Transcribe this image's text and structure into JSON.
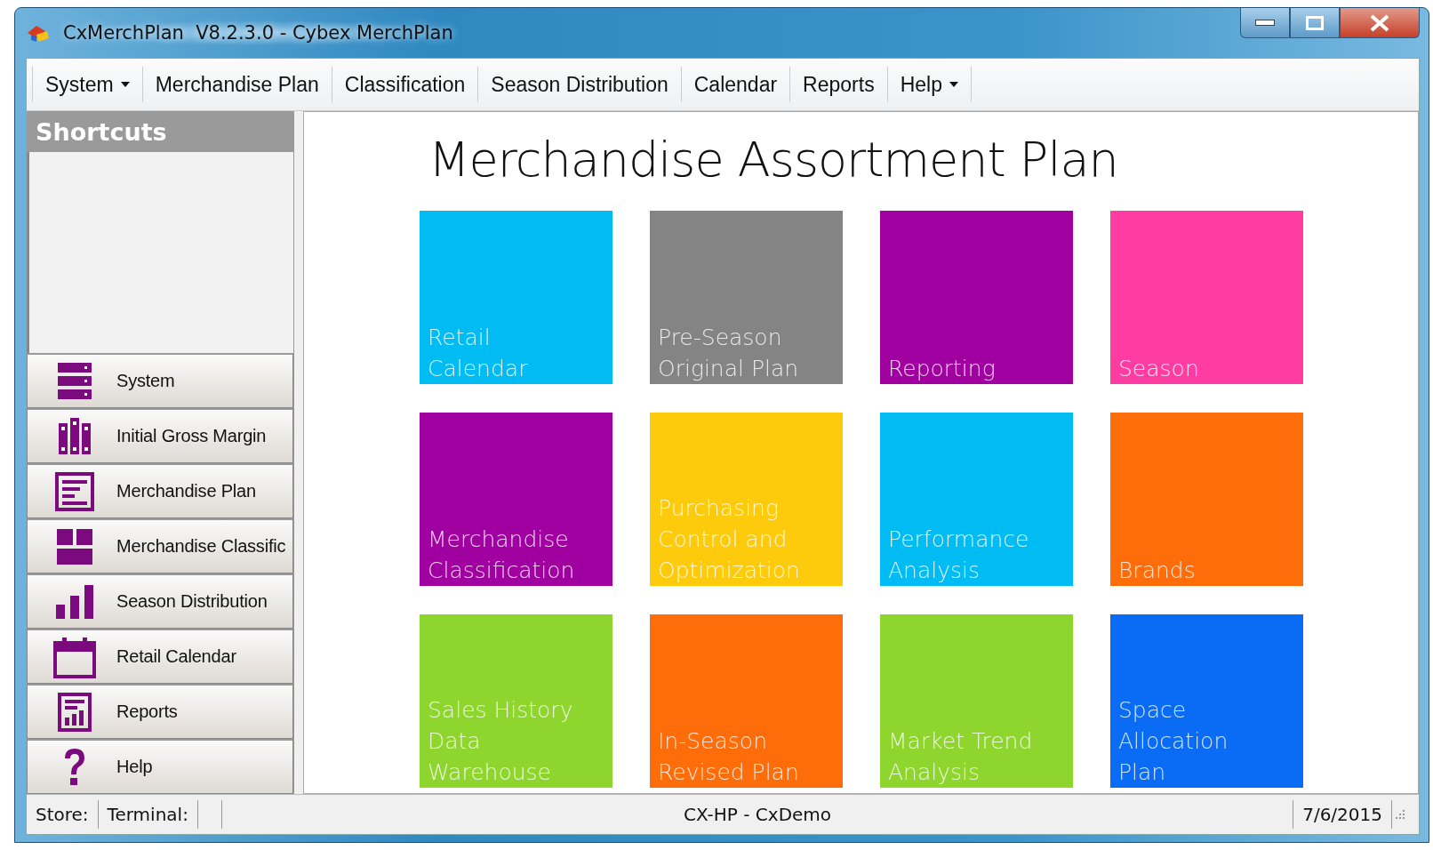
{
  "window": {
    "title": "CxMerchPlan  V8.2.3.0 - Cybex MerchPlan"
  },
  "menu": [
    {
      "label": "System",
      "dropdown": true
    },
    {
      "label": "Merchandise Plan",
      "dropdown": false
    },
    {
      "label": "Classification",
      "dropdown": false
    },
    {
      "label": "Season Distribution",
      "dropdown": false
    },
    {
      "label": "Calendar",
      "dropdown": false
    },
    {
      "label": "Reports",
      "dropdown": false
    },
    {
      "label": "Help",
      "dropdown": true
    }
  ],
  "sidebar": {
    "title": "Shortcuts",
    "items": [
      {
        "label": "System",
        "kind": "server"
      },
      {
        "label": "Initial Gross Margin",
        "kind": "columns"
      },
      {
        "label": "Merchandise Plan",
        "kind": "document"
      },
      {
        "label": "Merchandise Classific",
        "kind": "blocks"
      },
      {
        "label": "Season Distribution",
        "kind": "bars"
      },
      {
        "label": "Retail Calendar",
        "kind": "calendar"
      },
      {
        "label": "Reports",
        "kind": "report"
      },
      {
        "label": "Help",
        "kind": "question"
      }
    ]
  },
  "main": {
    "title": "Merchandise Assortment Plan",
    "tiles": [
      {
        "label": "Retail\nCalendar",
        "color": "#00bcf2"
      },
      {
        "label": "Pre-Season\nOriginal Plan",
        "color": "#848484"
      },
      {
        "label": "Reporting",
        "color": "#a0009f"
      },
      {
        "label": "Season",
        "color": "#ff3ca2"
      },
      {
        "label": "Merchandise\nClassification",
        "color": "#a0009f"
      },
      {
        "label": "Purchasing\nControl and\nOptimization",
        "color": "#fdcb0c"
      },
      {
        "label": "Performance\nAnalysis",
        "color": "#00bcf2"
      },
      {
        "label": "Brands",
        "color": "#ff6c0a"
      },
      {
        "label": "Sales History\nData\nWarehouse",
        "color": "#8ed52d"
      },
      {
        "label": "In-Season\nRevised Plan",
        "color": "#ff6c0a"
      },
      {
        "label": "Market Trend\nAnalysis",
        "color": "#8ed52d"
      },
      {
        "label": "Space\nAllocation\nPlan",
        "color": "#0a6cf5"
      }
    ]
  },
  "status_bar": {
    "store": "Store:",
    "terminal": "Terminal:",
    "center": "CX-HP - CxDemo",
    "date": "7/6/2015"
  }
}
